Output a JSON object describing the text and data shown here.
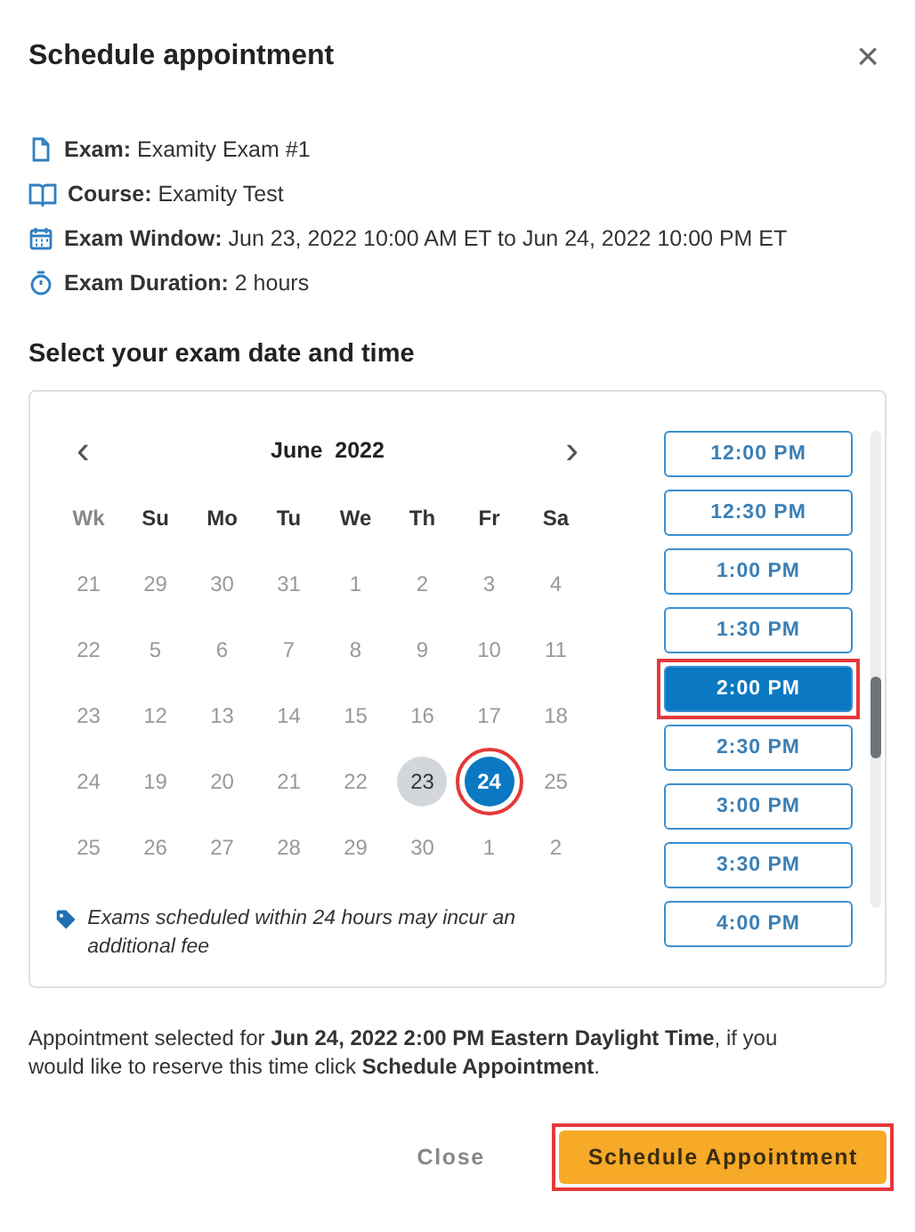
{
  "dialog": {
    "title": "Schedule appointment",
    "close": "×"
  },
  "details": [
    {
      "kind": "file",
      "label": "Exam:",
      "value": "Examity Exam #1"
    },
    {
      "kind": "book",
      "label": "Course:",
      "value": "Examity Test"
    },
    {
      "kind": "calendar",
      "label": "Exam Window:",
      "value": "Jun 23, 2022 10:00 AM ET to Jun 24, 2022 10:00 PM ET"
    },
    {
      "kind": "timer",
      "label": "Exam Duration:",
      "value": "2 hours"
    }
  ],
  "section_title": "Select your exam date and time",
  "calendar": {
    "prev": "‹",
    "next": "›",
    "month": "June  2022",
    "week_header": "Wk",
    "weekdays": [
      "Su",
      "Mo",
      "Tu",
      "We",
      "Th",
      "Fr",
      "Sa"
    ],
    "weeks": [
      {
        "week": "21",
        "days": [
          {
            "text": "29",
            "available": false,
            "selected": false
          },
          {
            "text": "30",
            "available": false,
            "selected": false
          },
          {
            "text": "31",
            "available": false,
            "selected": false
          },
          {
            "text": "1",
            "available": false,
            "selected": false
          },
          {
            "text": "2",
            "available": false,
            "selected": false
          },
          {
            "text": "3",
            "available": false,
            "selected": false
          },
          {
            "text": "4",
            "available": false,
            "selected": false
          }
        ]
      },
      {
        "week": "22",
        "days": [
          {
            "text": "5",
            "available": false,
            "selected": false
          },
          {
            "text": "6",
            "available": false,
            "selected": false
          },
          {
            "text": "7",
            "available": false,
            "selected": false
          },
          {
            "text": "8",
            "available": false,
            "selected": false
          },
          {
            "text": "9",
            "available": false,
            "selected": false
          },
          {
            "text": "10",
            "available": false,
            "selected": false
          },
          {
            "text": "11",
            "available": false,
            "selected": false
          }
        ]
      },
      {
        "week": "23",
        "days": [
          {
            "text": "12",
            "available": false,
            "selected": false
          },
          {
            "text": "13",
            "available": false,
            "selected": false
          },
          {
            "text": "14",
            "available": false,
            "selected": false
          },
          {
            "text": "15",
            "available": false,
            "selected": false
          },
          {
            "text": "16",
            "available": false,
            "selected": false
          },
          {
            "text": "17",
            "available": false,
            "selected": false
          },
          {
            "text": "18",
            "available": false,
            "selected": false
          }
        ]
      },
      {
        "week": "24",
        "days": [
          {
            "text": "19",
            "available": false,
            "selected": false
          },
          {
            "text": "20",
            "available": false,
            "selected": false
          },
          {
            "text": "21",
            "available": false,
            "selected": false
          },
          {
            "text": "22",
            "available": false,
            "selected": false
          },
          {
            "text": "23",
            "available": true,
            "selected": false
          },
          {
            "text": "24",
            "available": true,
            "selected": true,
            "highlighted": true
          },
          {
            "text": "25",
            "available": false,
            "selected": false
          }
        ]
      },
      {
        "week": "25",
        "days": [
          {
            "text": "26",
            "available": false,
            "selected": false
          },
          {
            "text": "27",
            "available": false,
            "selected": false
          },
          {
            "text": "28",
            "available": false,
            "selected": false
          },
          {
            "text": "29",
            "available": false,
            "selected": false
          },
          {
            "text": "30",
            "available": false,
            "selected": false
          },
          {
            "text": "1",
            "available": false,
            "selected": false
          },
          {
            "text": "2",
            "available": false,
            "selected": false
          }
        ]
      }
    ],
    "note": "Exams scheduled within 24 hours may incur an additional fee"
  },
  "times": [
    {
      "text": "12:00 PM",
      "selected": false
    },
    {
      "text": "12:30 PM",
      "selected": false
    },
    {
      "text": "1:00 PM",
      "selected": false
    },
    {
      "text": "1:30 PM",
      "selected": false
    },
    {
      "text": "2:00 PM",
      "selected": true,
      "highlighted": true
    },
    {
      "text": "2:30 PM",
      "selected": false
    },
    {
      "text": "3:00 PM",
      "selected": false
    },
    {
      "text": "3:30 PM",
      "selected": false
    },
    {
      "text": "4:00 PM",
      "selected": false
    }
  ],
  "summary": "Appointment selected for **Jun 24, 2022 2:00 PM Eastern Daylight Time**, if you would like to reserve this time click **Schedule Appointment**.",
  "buttons": [
    {
      "kind": "secondary",
      "label": "Close"
    },
    {
      "kind": "primary",
      "label": "Schedule Appointment",
      "highlighted": true
    }
  ]
}
